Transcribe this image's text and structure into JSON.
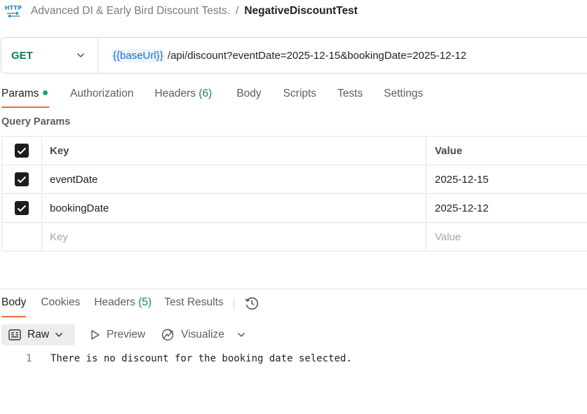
{
  "breadcrumb": {
    "icon_label": "HTTP",
    "parent": "Advanced DI & Early Bird Discount Tests.",
    "separator": "/",
    "current": "NegativeDiscountTest"
  },
  "request": {
    "method": "GET",
    "url_variable": "{{baseUrl}}",
    "url_path": "/api/discount?eventDate=2025-12-15&bookingDate=2025-12-12"
  },
  "request_tabs": [
    {
      "label": "Params",
      "active": true,
      "has_dot": true
    },
    {
      "label": "Authorization"
    },
    {
      "label": "Headers",
      "count": "(6)"
    },
    {
      "label": "Body"
    },
    {
      "label": "Scripts"
    },
    {
      "label": "Tests"
    },
    {
      "label": "Settings"
    }
  ],
  "query_params": {
    "title": "Query Params",
    "header": {
      "key": "Key",
      "value": "Value"
    },
    "rows": [
      {
        "key": "eventDate",
        "value": "2025-12-15",
        "checked": true
      },
      {
        "key": "bookingDate",
        "value": "2025-12-12",
        "checked": true
      }
    ],
    "placeholder": {
      "key": "Key",
      "value": "Value"
    }
  },
  "response_tabs": [
    {
      "label": "Body",
      "active": true
    },
    {
      "label": "Cookies"
    },
    {
      "label": "Headers",
      "count": "(5)"
    },
    {
      "label": "Test Results"
    }
  ],
  "response_toolbar": {
    "format": "Raw",
    "preview": "Preview",
    "visualize": "Visualize"
  },
  "response_body": {
    "lines": [
      {
        "number": "1",
        "text": "There is no discount for the booking date selected."
      }
    ]
  },
  "colors": {
    "method_get": "#0b7f4a",
    "variable": "#1c6fc4",
    "active_tab_underline": "#f26b3a",
    "count": "#138a4a",
    "params_dot": "#1fa85c"
  }
}
